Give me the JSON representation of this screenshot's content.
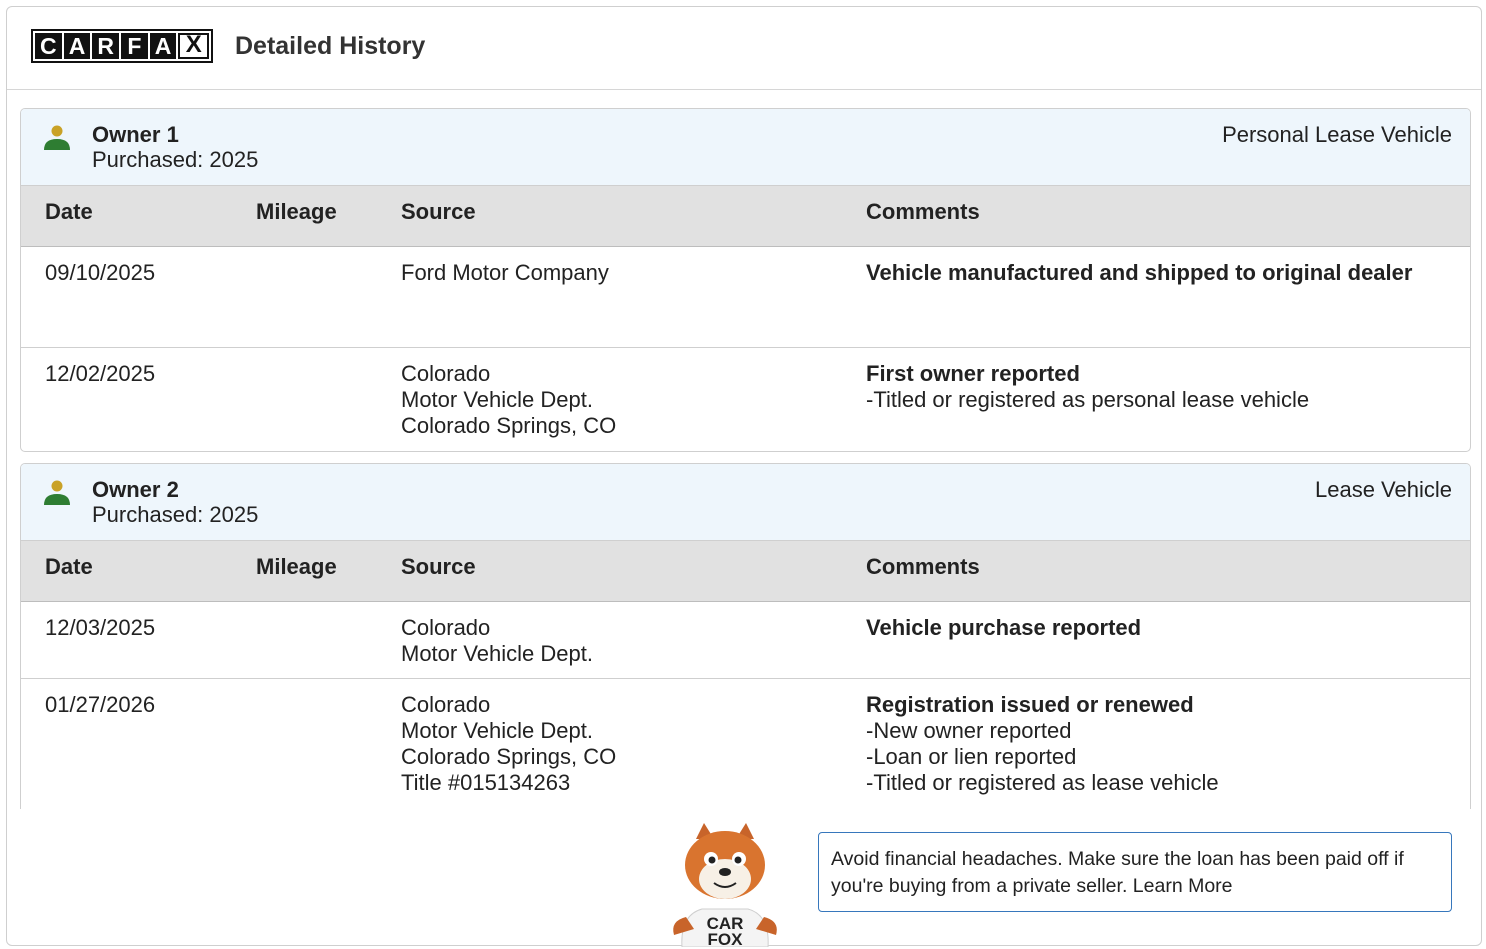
{
  "header": {
    "logo_letters": [
      "C",
      "A",
      "R",
      "F",
      "A",
      "X"
    ],
    "title": "Detailed History"
  },
  "table_columns": [
    "Date",
    "Mileage",
    "Source",
    "Comments"
  ],
  "owners": [
    {
      "name": "Owner 1",
      "purchased": "Purchased: 2025",
      "type": "Personal Lease Vehicle",
      "rows": [
        {
          "date": "09/10/2025",
          "mileage": "",
          "source": [
            "Ford Motor Company"
          ],
          "comment_title": "Vehicle manufactured and shipped to original dealer",
          "comment_items": []
        },
        {
          "date": "12/02/2025",
          "mileage": "",
          "source": [
            "Colorado",
            "Motor Vehicle Dept.",
            "Colorado Springs, CO"
          ],
          "comment_title": "First owner reported",
          "comment_items": [
            "-Titled or registered as personal lease vehicle"
          ]
        }
      ]
    },
    {
      "name": "Owner 2",
      "purchased": "Purchased: 2025",
      "type": "Lease Vehicle",
      "rows": [
        {
          "date": "12/03/2025",
          "mileage": "",
          "source": [
            "Colorado",
            "Motor Vehicle Dept."
          ],
          "comment_title": "Vehicle purchase reported",
          "comment_items": []
        },
        {
          "date": "01/27/2026",
          "mileage": "",
          "source": [
            "Colorado",
            "Motor Vehicle Dept.",
            "Colorado Springs, CO",
            "Title #015134263"
          ],
          "comment_title": "Registration issued or renewed",
          "comment_items": [
            "-New owner reported",
            "-Loan or lien reported",
            "-Titled or registered as lease vehicle"
          ]
        }
      ]
    }
  ],
  "tip": {
    "text": "Avoid financial headaches. Make sure the loan has been paid off if you're buying from a private seller.",
    "link_label": "Learn More",
    "mascot_shirt": [
      "CAR",
      "FOX"
    ]
  },
  "colors": {
    "owner_header_bg": "#eef6fc",
    "table_header_bg": "#e1e1e1",
    "owner_icon_head": "#c9a227",
    "owner_icon_body": "#2e7d32",
    "tip_border": "#3777bc"
  },
  "icons": {
    "owner": "person-icon",
    "mascot": "carfox-mascot"
  }
}
